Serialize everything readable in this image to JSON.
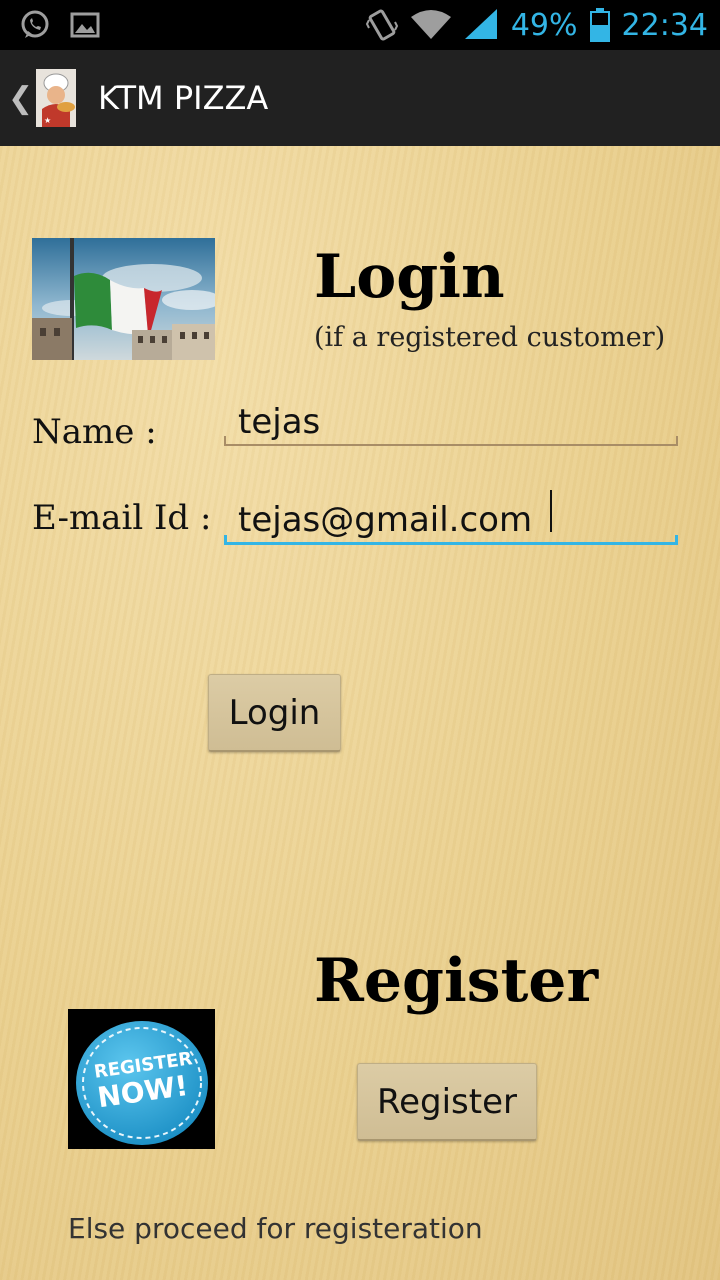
{
  "status_bar": {
    "battery_percent": "49%",
    "time": "22:34",
    "icons": [
      "whatsapp-icon",
      "gallery-icon",
      "vibrate-icon",
      "wifi-icon",
      "signal-icon",
      "battery-icon"
    ]
  },
  "action_bar": {
    "title": "KTM PIZZA",
    "up_icon": "back-caret-icon",
    "app_icon": "pizza-chef-icon"
  },
  "login": {
    "heading": "Login",
    "subheading": "(if a registered customer)",
    "image": "italian-flag-image",
    "name_label": "Name :",
    "name_value": "tejas",
    "email_label": "E-mail Id :",
    "email_value": "tejas@gmail.com",
    "button_label": "Login"
  },
  "register": {
    "heading": "Register",
    "image": "register-now-badge",
    "badge_line1": "REGISTER",
    "badge_line2": "NOW!",
    "button_label": "Register",
    "note": "Else proceed for registeration"
  },
  "colors": {
    "accent": "#33b5e5",
    "action_bar": "#212121",
    "parchment": "#ead08f"
  }
}
